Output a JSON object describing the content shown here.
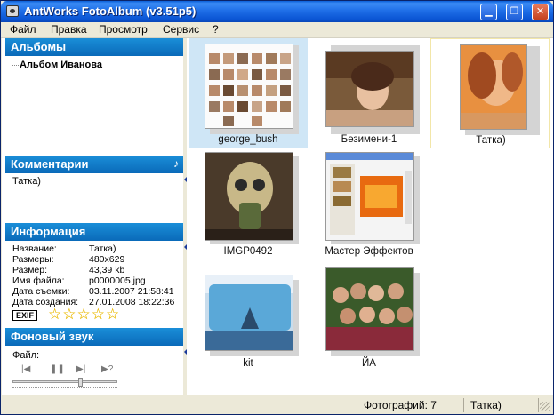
{
  "window": {
    "title": "AntWorks FotoAlbum (v3.51p5)"
  },
  "menu": {
    "items": [
      {
        "label": "Файл"
      },
      {
        "label": "Правка"
      },
      {
        "label": "Просмотр"
      },
      {
        "label": "Сервис"
      },
      {
        "label": "?"
      }
    ]
  },
  "albums": {
    "title": "Альбомы",
    "items": [
      "Альбом Иванова"
    ]
  },
  "comments": {
    "title": "Комментарии",
    "text": "Татка)"
  },
  "info": {
    "title": "Информация",
    "rows": [
      {
        "label": "Название:",
        "value": "Татка)"
      },
      {
        "label": "Размеры:",
        "value": "480x629"
      },
      {
        "label": "Размер:",
        "value": "43,39 kb"
      },
      {
        "label": "Имя файла:",
        "value": "p0000005.jpg"
      },
      {
        "label": "Дата съемки:",
        "value": "03.11.2007 21:58:41"
      },
      {
        "label": "Дата создания:",
        "value": "27.01.2008 18:22:36"
      }
    ],
    "exif_label": "EXIF",
    "rating": 0,
    "rating_max": 5
  },
  "sound": {
    "title": "Фоновый звук",
    "file_label": "Файл:",
    "controls": [
      "prev",
      "pause",
      "next",
      "random"
    ]
  },
  "gallery": {
    "items": [
      {
        "caption": "george_bush",
        "selected": true
      },
      {
        "caption": "Безимени-1",
        "selected": false
      },
      {
        "caption": "Татка)",
        "selected": false,
        "current": true
      },
      {
        "caption": "IMGP0492",
        "selected": false
      },
      {
        "caption": "Мастер Эффектов",
        "selected": false
      },
      {
        "caption": "kit",
        "selected": false
      },
      {
        "caption": "ЙА",
        "selected": false
      }
    ]
  },
  "status": {
    "count": "Фотографий: 7",
    "current": "Татка)"
  },
  "colors": {
    "accent": "#0a6ab9",
    "selection": "#cfe6f6",
    "title_bar": "#0b55d4"
  }
}
